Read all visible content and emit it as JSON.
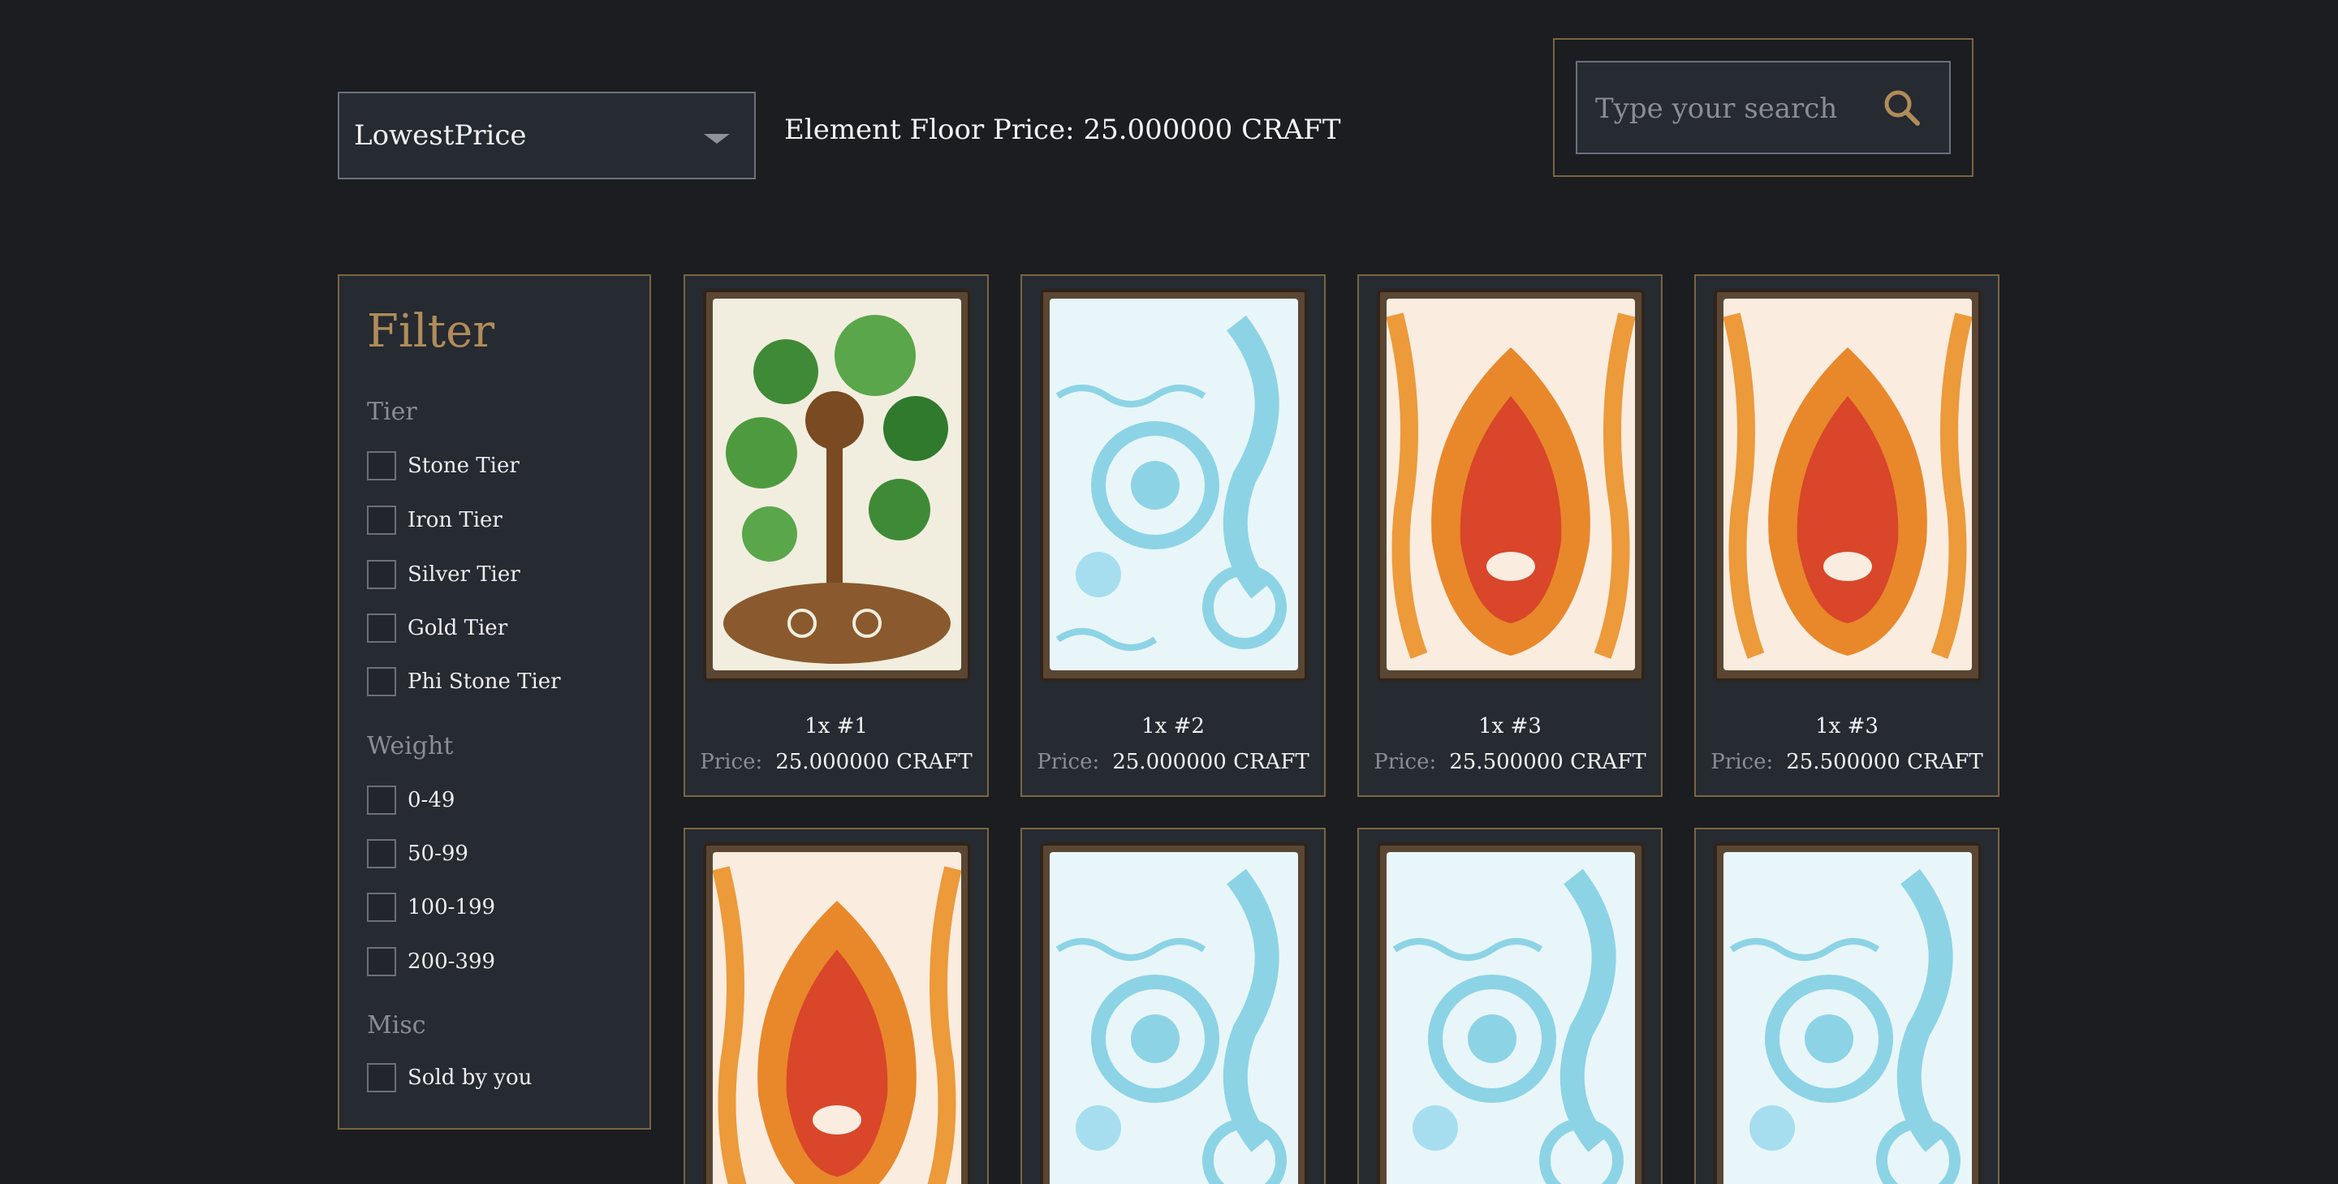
{
  "sort": {
    "selected": "LowestPrice"
  },
  "floor_price": "Element Floor Price: 25.000000 CRAFT",
  "search": {
    "placeholder": "Type your search"
  },
  "filter": {
    "title": "Filter",
    "sections": [
      {
        "label": "Tier",
        "options": [
          "Stone Tier",
          "Iron Tier",
          "Silver Tier",
          "Gold Tier",
          "Phi Stone Tier"
        ]
      },
      {
        "label": "Weight",
        "options": [
          "0-49",
          "50-99",
          "100-199",
          "200-399"
        ]
      },
      {
        "label": "Misc",
        "options": [
          "Sold by you"
        ]
      }
    ]
  },
  "price_label": "Price:",
  "colors": {
    "accent_gold": "#b08c5a",
    "border_gold": "#7a6540",
    "panel": "#262a31",
    "background": "#1b1d21"
  },
  "cards": [
    {
      "element": "earth",
      "qty": "1x #1",
      "price": "25.000000 CRAFT"
    },
    {
      "element": "water",
      "qty": "1x #2",
      "price": "25.000000 CRAFT"
    },
    {
      "element": "fire",
      "qty": "1x #3",
      "price": "25.500000 CRAFT"
    },
    {
      "element": "fire",
      "qty": "1x #3",
      "price": "25.500000 CRAFT"
    },
    {
      "element": "fire"
    },
    {
      "element": "water"
    },
    {
      "element": "water"
    },
    {
      "element": "water"
    }
  ]
}
